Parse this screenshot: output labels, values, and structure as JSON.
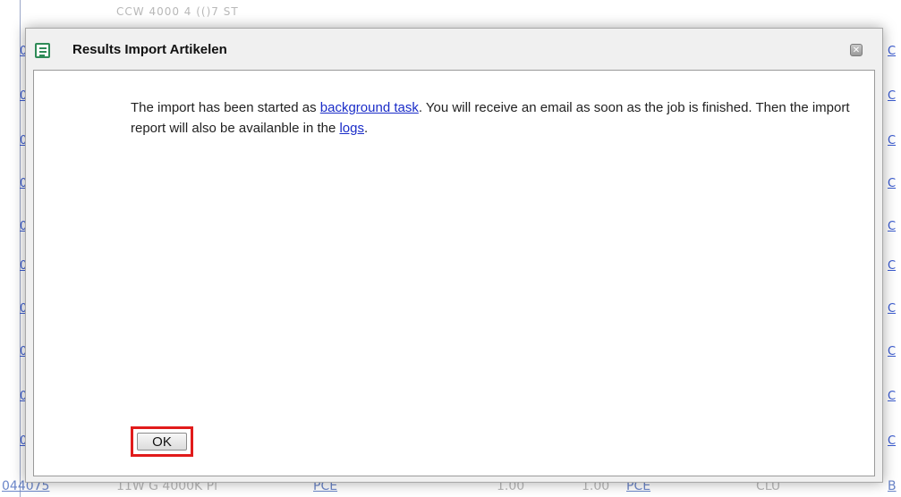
{
  "background": {
    "top_row_text": "CCW 4000 4 (()7 ST",
    "left_cells": [
      "0",
      "0",
      "0",
      "0",
      "0",
      "0",
      "0",
      "0",
      "0",
      "0"
    ],
    "right_cells": [
      "C",
      "C",
      "C",
      "C",
      "C",
      "C",
      "C",
      "C",
      "C",
      "C"
    ],
    "bottom_row": {
      "id": "044075",
      "description": "11W G 4000K Pl",
      "unit": "PCE",
      "qty1": "1.00",
      "qty2": "1.00",
      "unit2": "PCE",
      "code": "CLU",
      "tail": "B"
    }
  },
  "dialog": {
    "title": "Results Import Artikelen",
    "icon": "document-list-icon",
    "close_symbol": "✕",
    "message": {
      "part1": "The import has been started as ",
      "link1": "background task",
      "part2": ". You will receive an email as soon as the job is finished. Then the import report will also be availanble in the ",
      "link2": "logs",
      "part3": "."
    },
    "ok_label": "OK",
    "ok_highlight_color": "#e11b1b"
  }
}
